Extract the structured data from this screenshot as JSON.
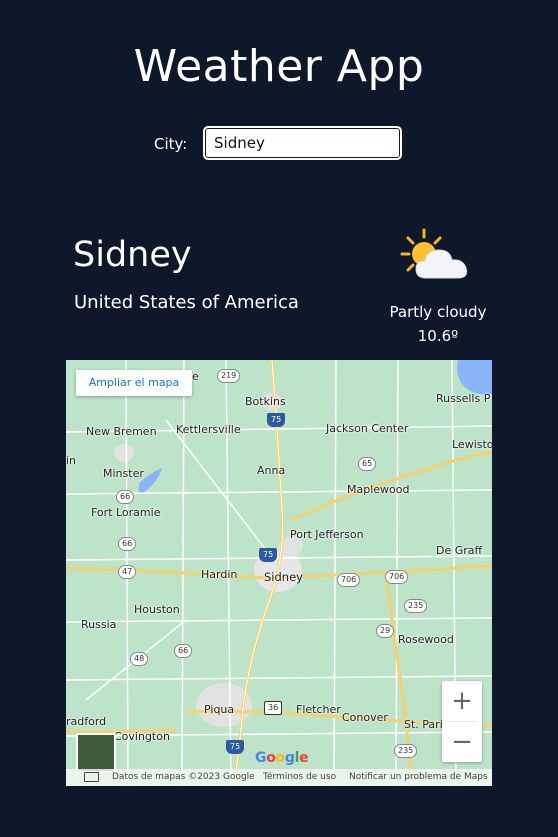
{
  "header": {
    "title": "Weather App"
  },
  "search": {
    "label": "City:",
    "value": "Sidney"
  },
  "location": {
    "name": "Sidney",
    "country": "United States of America"
  },
  "weather": {
    "condition": "Partly cloudy",
    "temperature": "10.6º",
    "icon": "partly-cloudy-icon"
  },
  "map": {
    "enlarge_label": "Ampliar el mapa",
    "zoom_in": "+",
    "zoom_out": "−",
    "logo": "Google",
    "attribution": {
      "data": "Datos de mapas ©2023 Google",
      "terms": "Términos de uso",
      "report": "Notificar un problema de Maps"
    },
    "places": [
      "lle",
      "Botkins",
      "Russells P",
      "New Bremen",
      "Kettlersville",
      "Jackson Center",
      "Lewisto",
      "in",
      "Minster",
      "Anna",
      "Maplewood",
      "Fort Loramie",
      "Port Jefferson",
      "De Graff",
      "Hardin",
      "Sidney",
      "Houston",
      "Russia",
      "Rosewood",
      "Piqua",
      "Fletcher",
      "Conover",
      "St. Pari",
      "radford",
      "Covington"
    ],
    "shields": [
      "219",
      "75",
      "65",
      "66",
      "66",
      "75",
      "47",
      "706",
      "706",
      "235",
      "29",
      "48",
      "66",
      "36",
      "75",
      "235"
    ]
  }
}
